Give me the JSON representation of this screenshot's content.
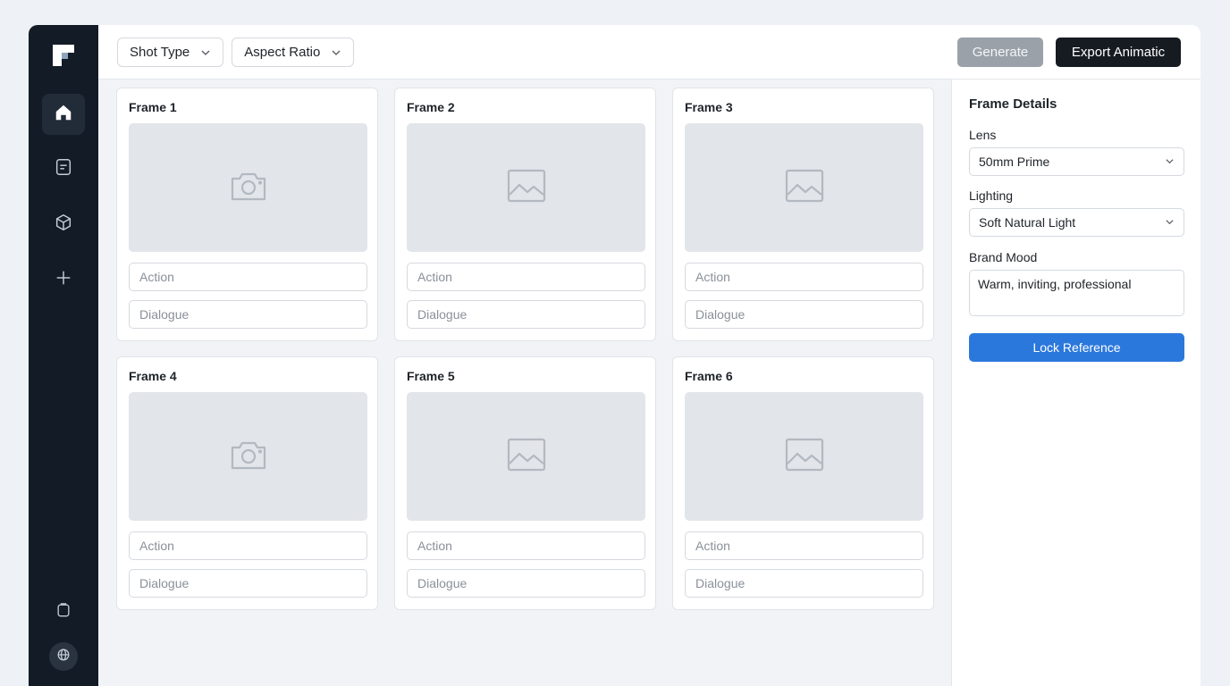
{
  "toolbar": {
    "shot_type_label": "Shot Type",
    "aspect_ratio_label": "Aspect Ratio",
    "generate_label": "Generate",
    "export_label": "Export Animatic"
  },
  "frames": [
    {
      "title": "Frame 1",
      "icon": "camera-icon",
      "action_placeholder": "Action",
      "dialogue_placeholder": "Dialogue"
    },
    {
      "title": "Frame 2",
      "icon": "image-icon",
      "action_placeholder": "Action",
      "dialogue_placeholder": "Dialogue"
    },
    {
      "title": "Frame 3",
      "icon": "image-icon",
      "action_placeholder": "Action",
      "dialogue_placeholder": "Dialogue"
    },
    {
      "title": "Frame 4",
      "icon": "camera-icon",
      "action_placeholder": "Action",
      "dialogue_placeholder": "Dialogue"
    },
    {
      "title": "Frame 5",
      "icon": "image-icon",
      "action_placeholder": "Action",
      "dialogue_placeholder": "Dialogue"
    },
    {
      "title": "Frame 6",
      "icon": "image-icon",
      "action_placeholder": "Action",
      "dialogue_placeholder": "Dialogue"
    }
  ],
  "details": {
    "title": "Frame Details",
    "lens_label": "Lens",
    "lens_value": "50mm Prime",
    "lighting_label": "Lighting",
    "lighting_value": "Soft Natural Light",
    "brand_mood_label": "Brand Mood",
    "brand_mood_value": "Warm, inviting, professional",
    "lock_label": "Lock Reference"
  },
  "sidebar": {
    "items": [
      {
        "icon": "home-icon",
        "active": true
      },
      {
        "icon": "document-icon",
        "active": false
      },
      {
        "icon": "cube-icon",
        "active": false
      },
      {
        "icon": "plus-icon",
        "active": false
      }
    ],
    "bottom": [
      {
        "icon": "clipboard-icon"
      },
      {
        "icon": "globe-icon"
      }
    ]
  },
  "colors": {
    "sidebar_bg": "#131b26",
    "primary_blue": "#2b78dc",
    "export_bg": "#161b22",
    "generate_bg": "#9aa1a9"
  }
}
